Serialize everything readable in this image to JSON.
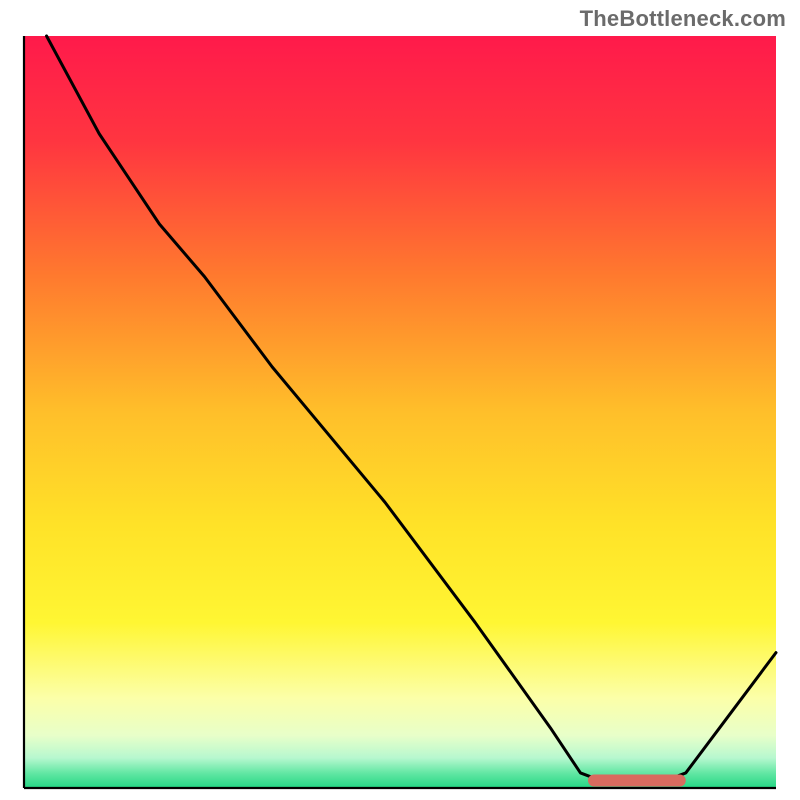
{
  "watermark": {
    "text": "TheBottleneck.com"
  },
  "chart_data": {
    "type": "line",
    "title": "",
    "xlabel": "",
    "ylabel": "",
    "xlim": [
      0,
      100
    ],
    "ylim": [
      0,
      100
    ],
    "grid": false,
    "legend": false,
    "gradient_stops": [
      {
        "pct": 0,
        "color": "#ff1a4b"
      },
      {
        "pct": 14,
        "color": "#ff3540"
      },
      {
        "pct": 32,
        "color": "#ff7a2e"
      },
      {
        "pct": 50,
        "color": "#ffbf2a"
      },
      {
        "pct": 65,
        "color": "#ffe228"
      },
      {
        "pct": 78,
        "color": "#fff633"
      },
      {
        "pct": 88,
        "color": "#fcffa8"
      },
      {
        "pct": 93,
        "color": "#e8ffc9"
      },
      {
        "pct": 96,
        "color": "#b7f8cf"
      },
      {
        "pct": 98,
        "color": "#63e7a4"
      },
      {
        "pct": 100,
        "color": "#24d684"
      }
    ],
    "series": [
      {
        "name": "curve",
        "points": [
          {
            "x": 3,
            "y": 100
          },
          {
            "x": 10,
            "y": 87
          },
          {
            "x": 18,
            "y": 75
          },
          {
            "x": 24,
            "y": 68
          },
          {
            "x": 33,
            "y": 56
          },
          {
            "x": 48,
            "y": 38
          },
          {
            "x": 60,
            "y": 22
          },
          {
            "x": 70,
            "y": 8
          },
          {
            "x": 74,
            "y": 2
          },
          {
            "x": 78,
            "y": 0.5
          },
          {
            "x": 84,
            "y": 0.5
          },
          {
            "x": 88,
            "y": 2
          },
          {
            "x": 94,
            "y": 10
          },
          {
            "x": 100,
            "y": 18
          }
        ]
      }
    ],
    "marker_band": {
      "color": "#d96b5f",
      "x_start": 75,
      "x_end": 88,
      "y": 1,
      "thickness": 1.6
    },
    "axes": {
      "x_baseline": true,
      "y_baseline": true,
      "stroke": "#000000",
      "stroke_width": 2.2
    }
  }
}
